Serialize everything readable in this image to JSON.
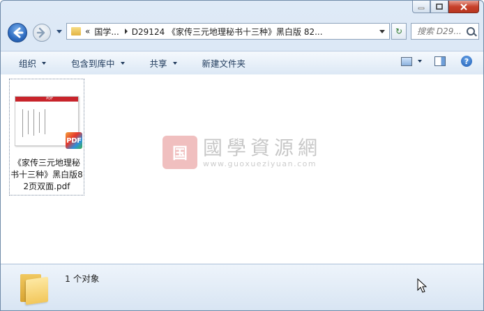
{
  "address": {
    "overflow": "«",
    "crumb1": "国学...",
    "crumb2": "D29124 《家传三元地理秘书十三种》黑白版 82..."
  },
  "search": {
    "placeholder": "搜索 D29..."
  },
  "toolbar": {
    "organize": "组织",
    "include": "包含到库中",
    "share": "共享",
    "new_folder": "新建文件夹"
  },
  "file": {
    "name": "《家传三元地理秘书十三种》黑白版82页双面.pdf",
    "badge": "PDF",
    "thumb_header": "PDF"
  },
  "watermark": {
    "seal": "国",
    "title": "國學資源網",
    "url": "www.guoxueziyuan.com"
  },
  "status": {
    "count": "1 个对象"
  },
  "icons": [
    "back-icon",
    "forward-icon",
    "folder-icon",
    "refresh-icon",
    "search-icon",
    "view-icon",
    "preview-pane-icon",
    "help-icon",
    "pdf-icon",
    "minimize-icon",
    "maximize-icon",
    "close-icon"
  ]
}
